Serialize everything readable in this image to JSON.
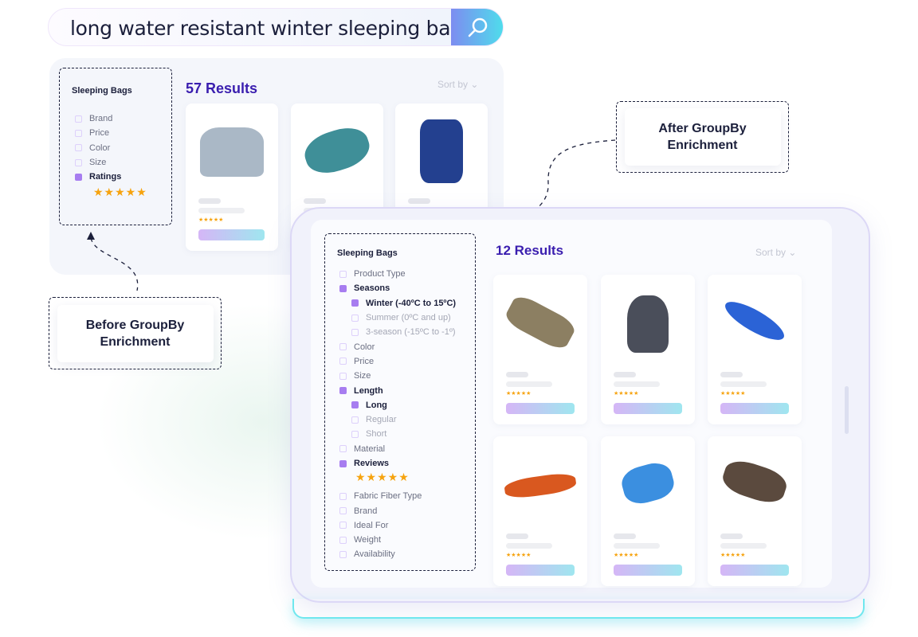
{
  "search": {
    "query": "long water resistant winter sleeping bag",
    "icon": "search-icon"
  },
  "before": {
    "label": "Before GroupBy Enrichment",
    "sidebar": {
      "title": "Sleeping Bags",
      "items": [
        {
          "label": "Brand",
          "checked": false
        },
        {
          "label": "Price",
          "checked": false
        },
        {
          "label": "Color",
          "checked": false
        },
        {
          "label": "Size",
          "checked": false
        },
        {
          "label": "Ratings",
          "checked": true
        }
      ],
      "stars": "★★★★★"
    },
    "results": "57 Results",
    "sort": "Sort by",
    "products": [
      {
        "image": "puffer-jacket",
        "color": "#aab8c6",
        "stars": "★★★★★"
      },
      {
        "image": "teal-sleeping-bag",
        "color": "#3f8f98",
        "stars": "★★★★★"
      },
      {
        "image": "blue-backpack",
        "color": "#23408f",
        "stars": "★★★★★"
      }
    ]
  },
  "after": {
    "label": "After GroupBy Enrichment",
    "sidebar": {
      "title": "Sleeping Bags",
      "items": [
        {
          "label": "Product Type",
          "checked": false,
          "level": 0
        },
        {
          "label": "Seasons",
          "checked": true,
          "level": 0
        },
        {
          "label": "Winter  (-40ºC to 15ºC)",
          "checked": true,
          "level": 1
        },
        {
          "label": "Summer (0ºC and up)",
          "checked": false,
          "level": 1
        },
        {
          "label": "3-season (-15ºC to -1º)",
          "checked": false,
          "level": 1
        },
        {
          "label": "Color",
          "checked": false,
          "level": 0
        },
        {
          "label": "Price",
          "checked": false,
          "level": 0
        },
        {
          "label": "Size",
          "checked": false,
          "level": 0
        },
        {
          "label": "Length",
          "checked": true,
          "level": 0
        },
        {
          "label": "Long",
          "checked": true,
          "level": 1
        },
        {
          "label": "Regular",
          "checked": false,
          "level": 1
        },
        {
          "label": "Short",
          "checked": false,
          "level": 1
        },
        {
          "label": "Material",
          "checked": false,
          "level": 0
        },
        {
          "label": "Reviews",
          "checked": true,
          "level": 0
        },
        {
          "stars": "★★★★★"
        },
        {
          "label": "Fabric Fiber Type",
          "checked": false,
          "level": 0
        },
        {
          "label": "Brand",
          "checked": false,
          "level": 0
        },
        {
          "label": "Ideal For",
          "checked": false,
          "level": 0
        },
        {
          "label": "Weight",
          "checked": false,
          "level": 0
        },
        {
          "label": "Availability",
          "checked": false,
          "level": 0
        }
      ]
    },
    "results": "12 Results",
    "sort": "Sort by",
    "products": [
      {
        "image": "tan-sleeping-bag",
        "color": "#8c7f62",
        "stars": "★★★★★"
      },
      {
        "image": "stuff-sack",
        "color": "#4a4e5a",
        "stars": "★★★★★"
      },
      {
        "image": "blue-mummy-bag",
        "color": "#2b63d6",
        "stars": "★★★★★"
      },
      {
        "image": "orange-sleeping-bag",
        "color": "#d9581f",
        "stars": "★★★★★"
      },
      {
        "image": "blue-compression-bag",
        "color": "#3b8fe0",
        "stars": "★★★★★"
      },
      {
        "image": "brown-sleeping-bag",
        "color": "#5b4a3e",
        "stars": "★★★★★"
      }
    ]
  },
  "colors": {
    "accent": "#3a1eaf",
    "checkbox": "#a77df0",
    "star": "#f6a30f"
  }
}
